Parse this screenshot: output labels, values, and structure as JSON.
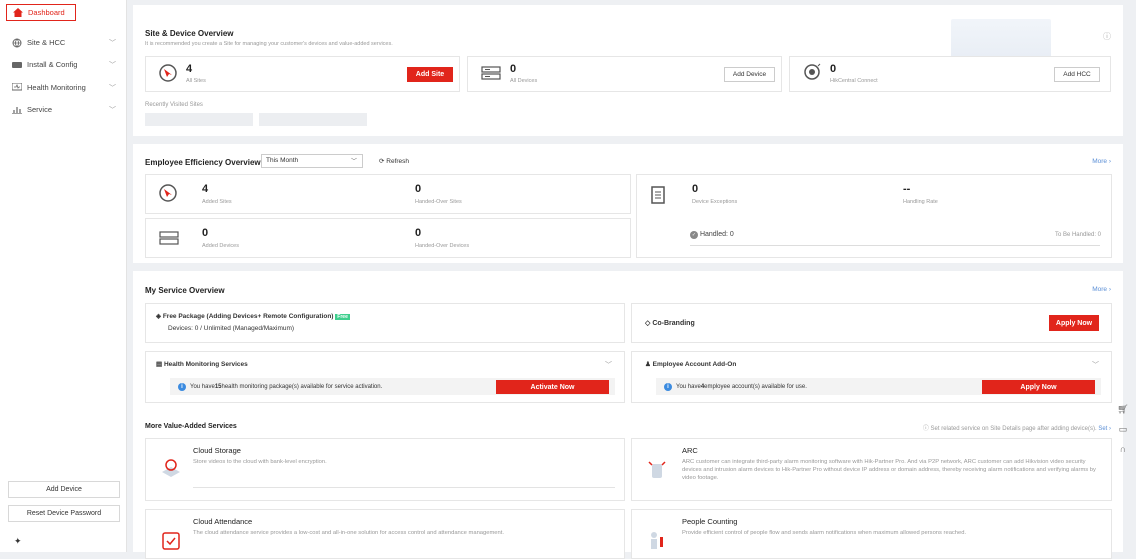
{
  "sidebar": {
    "items": [
      {
        "label": "Dashboard"
      },
      {
        "label": "Site & HCC"
      },
      {
        "label": "Install & Config"
      },
      {
        "label": "Health Monitoring"
      },
      {
        "label": "Service"
      }
    ],
    "add_device": "Add Device",
    "reset_password": "Reset Device Password"
  },
  "site_overview": {
    "title": "Site & Device Overview",
    "subtitle": "It is recommended you create a Site for managing your customer's devices and value-added services.",
    "sites_count": "4",
    "sites_label": "All Sites",
    "add_site": "Add Site",
    "devices_count": "0",
    "devices_label": "All Devices",
    "add_device": "Add Device",
    "hcc_count": "0",
    "hcc_label": "HikCentral Connect",
    "add_hcc": "Add HCC",
    "recent_label": "Recently Visited Sites"
  },
  "efficiency": {
    "title": "Employee Efficiency Overview",
    "period": "This Month",
    "refresh": "Refresh",
    "more": "More",
    "added_sites": "4",
    "added_sites_label": "Added Sites",
    "handed_sites": "0",
    "handed_sites_label": "Handed-Over Sites",
    "added_devices": "0",
    "added_devices_label": "Added Devices",
    "handed_devices": "0",
    "handed_devices_label": "Handed-Over Devices",
    "exceptions": "0",
    "exceptions_label": "Device Exceptions",
    "rate": "--",
    "rate_label": "Handling Rate",
    "handled": "Handled: 0",
    "to_handle": "To Be Handled: 0"
  },
  "service": {
    "title": "My Service Overview",
    "more": "More",
    "free_package": "Free Package (Adding Devices+ Remote Configuration)",
    "free_badge": "Free",
    "devices_usage": "Devices: 0 / Unlimited  (Managed/Maximum)",
    "cobranding": "Co-Branding",
    "apply_now": "Apply Now",
    "health_title": "Health Monitoring Services",
    "health_info_pre": "You have ",
    "health_info_num": "15",
    "health_info_post": " health monitoring package(s) available for service activation.",
    "activate_now": "Activate Now",
    "employee_title": "Employee Account Add-On",
    "employee_info_pre": "You have ",
    "employee_info_num": "4",
    "employee_info_post": " employee account(s) available for use.",
    "apply_now2": "Apply Now"
  },
  "value_added": {
    "title": "More Value-Added Services",
    "hint": "Set related service on Site Details page after adding device(s).",
    "set": "Set",
    "cloud_storage": "Cloud Storage",
    "cloud_storage_desc": "Store videos to the cloud with bank-level encryption.",
    "arc": "ARC",
    "arc_desc": "ARC customer can integrate third-party alarm monitoring software with Hik-Partner Pro. And via P2P network, ARC customer can add Hikvision video security devices and intrusion alarm devices to Hik-Partner Pro without device IP address or domain address, thereby receiving alarm notifications and verifying alarms by video footage.",
    "cloud_attendance": "Cloud Attendance",
    "cloud_attendance_desc": "The cloud attendance service provides a low-cost and all-in-one solution for access control and attendance management.",
    "people_counting": "People Counting",
    "people_counting_desc": "Provide efficient control of people flow and sends alarm notifications when maximum allowed persons reached."
  },
  "colors": {
    "accent": "#e1251b",
    "link": "#5b8fd6",
    "info": "#3b8be0"
  }
}
